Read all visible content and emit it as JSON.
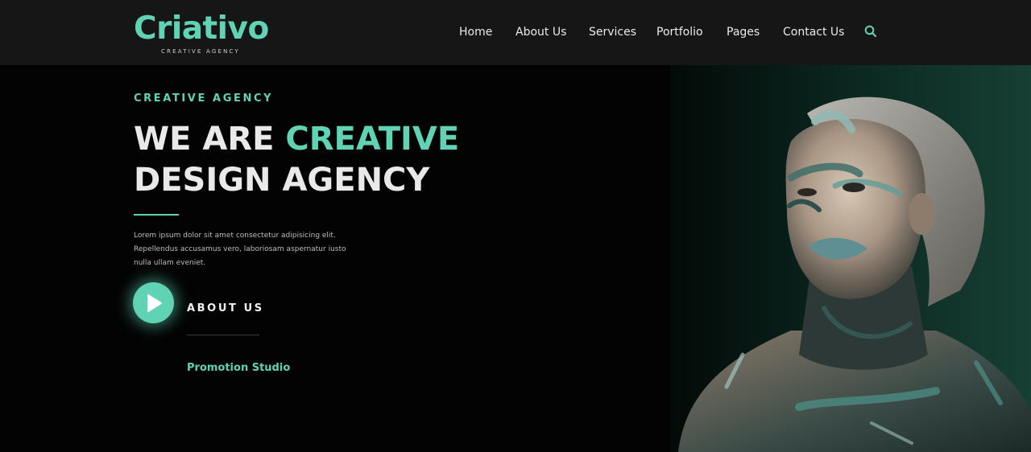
{
  "header": {
    "logo": {
      "word": "Criativo",
      "tagline": "CREATIVE AGENCY"
    },
    "nav": [
      "Home",
      "About Us",
      "Services",
      "Portfolio",
      "Pages",
      "Contact Us"
    ],
    "search_icon": "search-icon"
  },
  "hero": {
    "eyebrow": "CREATIVE AGENCY",
    "headline_part1": "WE ARE ",
    "headline_accent": "CREATIVE",
    "headline_line2": "DESIGN AGENCY",
    "lede_lines": [
      "Lorem ipsum dolor sit amet consectetur adipisicing elit.",
      "Repellendus accusamus vero, laboriosam aspernatur iusto",
      "nulla ullam eveniet."
    ],
    "cta_label": "ABOUT US",
    "cta_icon": "play-icon",
    "sub_link": "Promotion Studio"
  },
  "colors": {
    "accent": "#5fd3b4",
    "header_bg": "#161616",
    "page_bg": "#030303"
  }
}
